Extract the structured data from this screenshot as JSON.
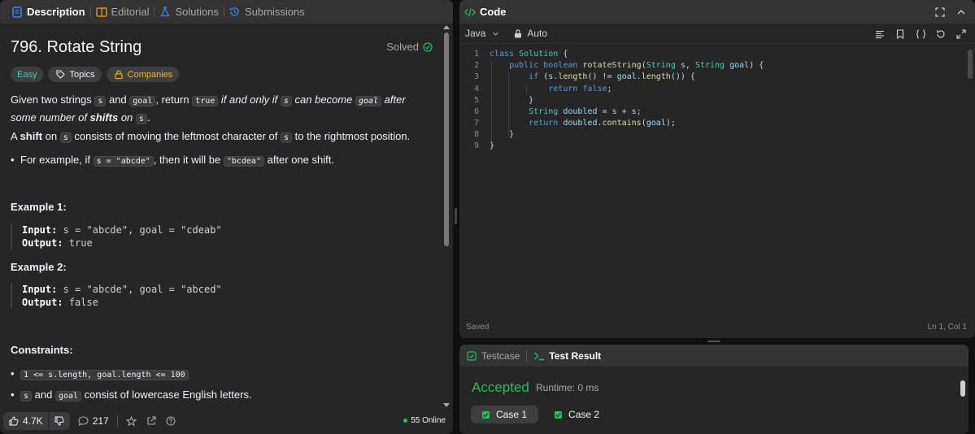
{
  "tabs": {
    "description": "Description",
    "editorial": "Editorial",
    "solutions": "Solutions",
    "submissions": "Submissions"
  },
  "problem": {
    "title": "796. Rotate String",
    "solved": "Solved",
    "difficulty": "Easy",
    "topics": "Topics",
    "companies": "Companies",
    "p1": {
      "a": "Given two strings ",
      "s": "s",
      "b": " and ",
      "goal": "goal",
      "c": ", return ",
      "true": "true",
      "d": " if and only if ",
      "e": " can become ",
      "f": " after some number of ",
      "shifts": "shifts",
      "g": " on ",
      "h": "."
    },
    "p2": {
      "a": "A ",
      "shift": "shift",
      "b": " on ",
      "c": " consists of moving the leftmost character of ",
      "d": " to the rightmost position."
    },
    "bullet1": {
      "a": "For example, if ",
      "code1": "s = \"abcde\"",
      "b": ", then it will be ",
      "code2": "\"bcdea\"",
      "c": " after one shift."
    },
    "example1": {
      "title": "Example 1:",
      "input_label": "Input:",
      "input": "s = \"abcde\", goal = \"cdeab\"",
      "output_label": "Output:",
      "output": "true"
    },
    "example2": {
      "title": "Example 2:",
      "input_label": "Input:",
      "input": "s = \"abcde\", goal = \"abced\"",
      "output_label": "Output:",
      "output": "false"
    },
    "constraints_title": "Constraints:",
    "constraint1": "1 <= s.length, goal.length <= 100",
    "constraint2": {
      "s": "s",
      "a": " and ",
      "goal": "goal",
      "b": " consist of lowercase English letters."
    }
  },
  "footer": {
    "likes": "4.7K",
    "comments": "217",
    "online": "55 Online"
  },
  "code": {
    "title": "Code",
    "language": "Java",
    "mode": "Auto",
    "line_numbers": [
      "1",
      "2",
      "3",
      "4",
      "5",
      "6",
      "7",
      "8",
      "9"
    ],
    "status": "Saved",
    "cursor": "Ln 1, Col 1"
  },
  "result": {
    "testcase_tab": "Testcase",
    "result_tab": "Test Result",
    "verdict": "Accepted",
    "runtime": "Runtime: 0 ms",
    "case1": "Case 1",
    "case2": "Case 2"
  },
  "colors": {
    "accepted": "#2cbb5d",
    "easy": "#46c6c2",
    "companies": "#ffb800",
    "description_icon": "#3b82f6",
    "editorial_icon": "#ffa116",
    "code_icon": "#2cbb5d"
  }
}
